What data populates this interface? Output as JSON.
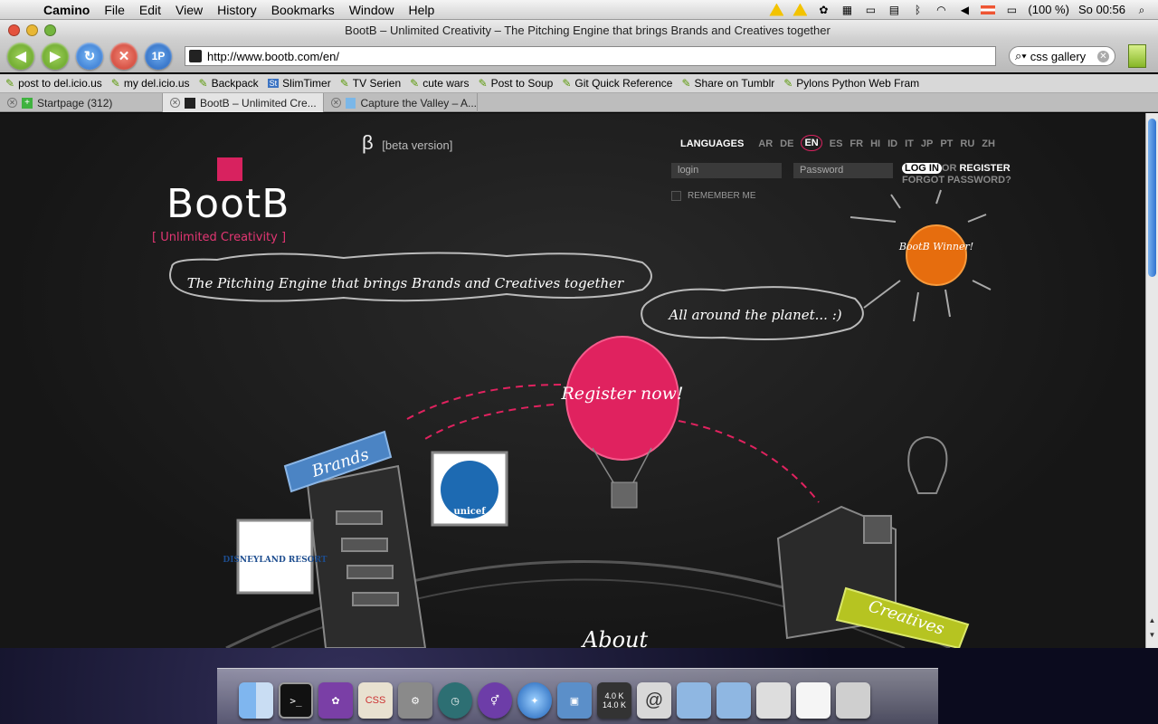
{
  "menubar": {
    "app": "Camino",
    "items": [
      "File",
      "Edit",
      "View",
      "History",
      "Bookmarks",
      "Window",
      "Help"
    ],
    "battery": "(100 %)",
    "clock": "So 00:56"
  },
  "window": {
    "title": "BootB – Unlimited Creativity – The Pitching Engine that brings Brands and Creatives together",
    "url": "http://www.bootb.com/en/",
    "search_value": "css gallery"
  },
  "bookmarks": [
    "post to del.icio.us",
    "my del.icio.us",
    "Backpack",
    "SlimTimer",
    "TV Serien",
    "cute wars",
    "Post to Soup",
    "Git Quick Reference",
    "Share on Tumblr",
    "Pylons Python Web Fram"
  ],
  "tabs": [
    {
      "label": "Startpage (312)"
    },
    {
      "label": "BootB – Unlimited Cre..."
    },
    {
      "label": "Capture the Valley – A..."
    }
  ],
  "page": {
    "logo_word": "BootB",
    "tagline": "[ Unlimited Creativity ]",
    "beta_symbol": "β",
    "beta": "[beta version]",
    "languages_label": "LANGUAGES",
    "languages": [
      "AR",
      "DE",
      "EN",
      "ES",
      "FR",
      "HI",
      "ID",
      "IT",
      "JP",
      "PT",
      "RU",
      "ZH"
    ],
    "active_language": "EN",
    "login_placeholder": "login",
    "password_placeholder": "Password",
    "login_button": "LOG IN",
    "or": "OR",
    "register": "REGISTER",
    "forgot": "FORGOT PASSWORD?",
    "remember": "REMEMBER ME",
    "cloud1": "The Pitching Engine that brings Brands and Creatives together",
    "cloud2": "All around the planet... :)",
    "sun_text": "BootB Winner!",
    "balloon": "Register now!",
    "brands": "Brands",
    "creatives": "Creatives",
    "about": "About",
    "logo1": "unicef",
    "logo2": "DISNEYLAND RESORT"
  },
  "dock": {
    "net_up": "4.0 K",
    "net_down": "14.0 K"
  },
  "colors": {
    "accent_pink": "#d8225f",
    "sun_orange": "#e66d0e",
    "brands_blue": "#4b84c4",
    "creatives_green": "#b6c421"
  }
}
